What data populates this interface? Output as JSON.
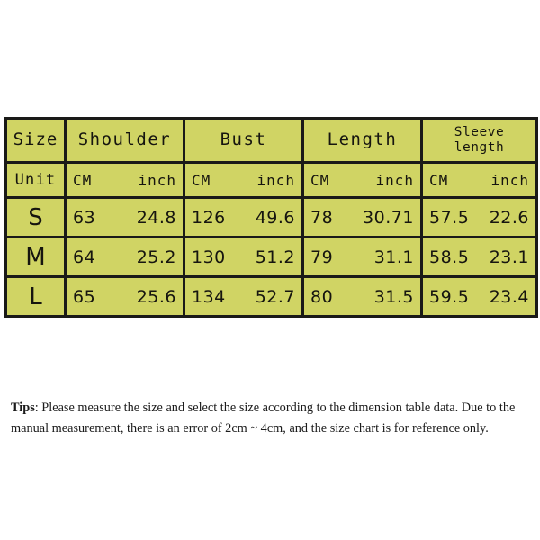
{
  "table": {
    "header": {
      "size_label": "Size",
      "columns": [
        {
          "name": "Shoulder",
          "wrap": false
        },
        {
          "name": "Bust",
          "wrap": false
        },
        {
          "name": "Length",
          "wrap": false
        },
        {
          "name": "Sleeve length",
          "wrap": true,
          "line1": "Sleeve",
          "line2": "length"
        }
      ]
    },
    "unit_row": {
      "label": "Unit",
      "cm": "CM",
      "inch": "inch"
    },
    "rows": [
      {
        "size": "S",
        "shoulder_cm": "63",
        "shoulder_inch": "24.8",
        "bust_cm": "126",
        "bust_inch": "49.6",
        "length_cm": "78",
        "length_inch": "30.71",
        "sleeve_cm": "57.5",
        "sleeve_inch": "22.6"
      },
      {
        "size": "M",
        "shoulder_cm": "64",
        "shoulder_inch": "25.2",
        "bust_cm": "130",
        "bust_inch": "51.2",
        "length_cm": "79",
        "length_inch": "31.1",
        "sleeve_cm": "58.5",
        "sleeve_inch": "23.1"
      },
      {
        "size": "L",
        "shoulder_cm": "65",
        "shoulder_inch": "25.6",
        "bust_cm": "134",
        "bust_inch": "52.7",
        "length_cm": "80",
        "length_inch": "31.5",
        "sleeve_cm": "59.5",
        "sleeve_inch": "23.4"
      }
    ]
  },
  "tips": {
    "label": "Tips",
    "text": ": Please measure the size and select the size according to the dimension table data. Due to the manual measurement, there is an error of 2cm ~ 4cm, and the size chart is for reference only."
  },
  "colors": {
    "cell_background": "#d0d464",
    "border": "#1a1a18",
    "page_background": "#ffffff",
    "text": "#16150f"
  }
}
